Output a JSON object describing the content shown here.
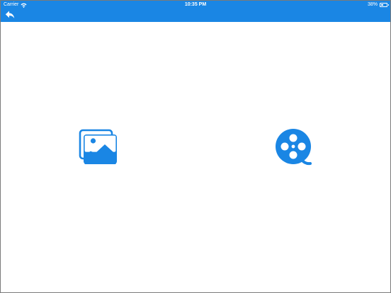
{
  "status_bar": {
    "carrier": "Carrier",
    "time": "10:35 PM",
    "battery_text": "38%",
    "battery_level": 0.38
  },
  "navigation": {
    "back_icon": "back-arrow-icon"
  },
  "actions": {
    "gallery_icon": "photo-gallery-icon",
    "video_icon": "film-reel-icon"
  },
  "colors": {
    "accent": "#1a86e4",
    "background": "#ffffff"
  }
}
